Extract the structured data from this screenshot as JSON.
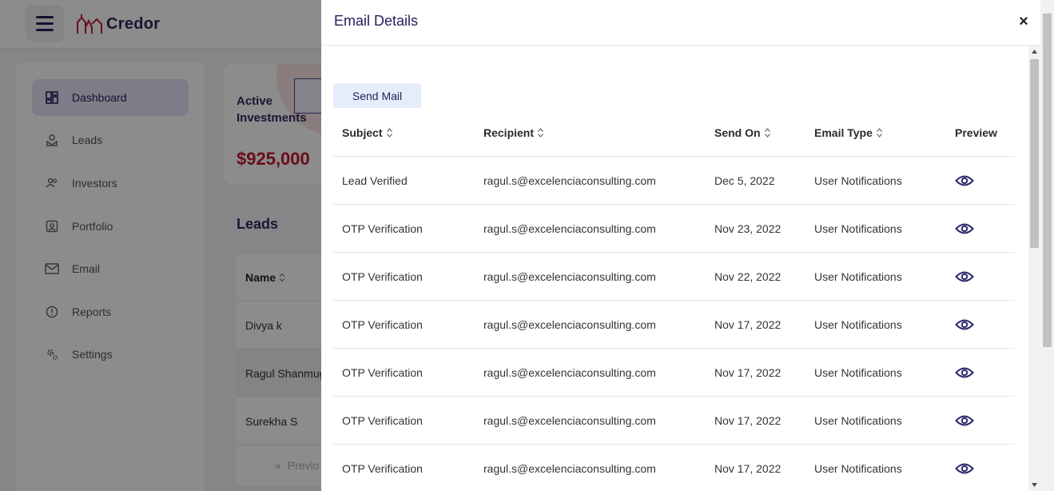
{
  "app": {
    "logo_text": "Credor",
    "nav": [
      {
        "label": "Dashboard",
        "icon": "dashboard-icon",
        "active": true
      },
      {
        "label": "Leads",
        "icon": "leads-icon"
      },
      {
        "label": "Investors",
        "icon": "investors-icon"
      },
      {
        "label": "Portfolio",
        "icon": "portfolio-icon"
      },
      {
        "label": "Email",
        "icon": "email-icon"
      },
      {
        "label": "Reports",
        "icon": "reports-icon"
      },
      {
        "label": "Settings",
        "icon": "settings-icon"
      }
    ],
    "active_investments": {
      "title": "Active Investments",
      "value": "$925,000"
    },
    "leads": {
      "title": "Leads",
      "column": "Name",
      "rows": [
        "Divya k",
        "Ragul Shanmug",
        "Surekha S"
      ],
      "pager_prev": "Previo"
    }
  },
  "drawer": {
    "title": "Email Details",
    "close_label": "×",
    "send_mail_label": "Send Mail",
    "columns": [
      "Subject",
      "Recipient",
      "Send On",
      "Email Type",
      "Preview"
    ],
    "rows": [
      {
        "subject": "Lead Verified",
        "recipient": "ragul.s@excelenciaconsulting.com",
        "sent_on": "Dec 5, 2022",
        "type": "User Notifications"
      },
      {
        "subject": "OTP Verification",
        "recipient": "ragul.s@excelenciaconsulting.com",
        "sent_on": "Nov 23, 2022",
        "type": "User Notifications"
      },
      {
        "subject": "OTP Verification",
        "recipient": "ragul.s@excelenciaconsulting.com",
        "sent_on": "Nov 22, 2022",
        "type": "User Notifications"
      },
      {
        "subject": "OTP Verification",
        "recipient": "ragul.s@excelenciaconsulting.com",
        "sent_on": "Nov 17, 2022",
        "type": "User Notifications"
      },
      {
        "subject": "OTP Verification",
        "recipient": "ragul.s@excelenciaconsulting.com",
        "sent_on": "Nov 17, 2022",
        "type": "User Notifications"
      },
      {
        "subject": "OTP Verification",
        "recipient": "ragul.s@excelenciaconsulting.com",
        "sent_on": "Nov 17, 2022",
        "type": "User Notifications"
      },
      {
        "subject": "OTP Verification",
        "recipient": "ragul.s@excelenciaconsulting.com",
        "sent_on": "Nov 17, 2022",
        "type": "User Notifications"
      }
    ]
  },
  "colors": {
    "brand": "#23215a",
    "accent_red": "#c0192e",
    "button_bg": "#e7ecfb"
  }
}
